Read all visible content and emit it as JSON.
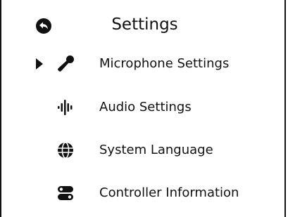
{
  "header": {
    "title": "Settings",
    "back_icon": "back-arrow-icon"
  },
  "menu": {
    "selected_index": 0,
    "items": [
      {
        "label": "Microphone Settings",
        "icon": "microphone-icon"
      },
      {
        "label": "Audio Settings",
        "icon": "audio-waveform-icon"
      },
      {
        "label": "System Language",
        "icon": "globe-icon"
      },
      {
        "label": "Controller Information",
        "icon": "controller-icon"
      }
    ]
  },
  "colors": {
    "foreground": "#111111",
    "background": "#ffffff"
  }
}
